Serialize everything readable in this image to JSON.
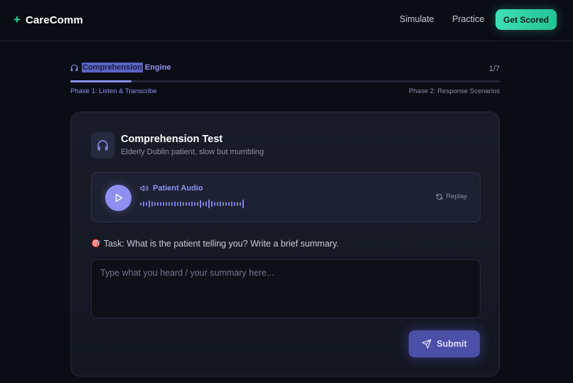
{
  "header": {
    "logo_symbol": "+",
    "logo_text": "CareComm",
    "nav": [
      "Simulate",
      "Practice"
    ],
    "cta_label": "Get Scored"
  },
  "progress": {
    "engine_highlight": "Comprehension",
    "engine_rest": " Engine",
    "step": "1/7",
    "fraction_complete": 0.143,
    "phase_current": "Phase 1: Listen & Transcribe",
    "phase_next": "Phase 2: Response Scenarios"
  },
  "card": {
    "title": "Comprehension Test",
    "subtitle": "Elderly Dublin patient, slow but mumbling",
    "icon": "headphones-icon"
  },
  "audio": {
    "label": "Patient Audio",
    "replay_label": "Replay",
    "waveform_levels": [
      0.3,
      0.5,
      0.4,
      0.7,
      0.5,
      0.4,
      0.4,
      0.4,
      0.4,
      0.4,
      0.4,
      0.4,
      0.5,
      0.4,
      0.5,
      0.4,
      0.4,
      0.4,
      0.5,
      0.4,
      0.4,
      0.8,
      0.4,
      0.5,
      0.9,
      0.6,
      0.4,
      0.4,
      0.5,
      0.4,
      0.4,
      0.4,
      0.5,
      0.4,
      0.4,
      0.4,
      0.9
    ]
  },
  "task": {
    "emoji": "🎯",
    "text": "Task: What is the patient telling you? Write a brief summary.",
    "placeholder": "Type what you heard / your summary here...",
    "value": ""
  },
  "submit_label": "Submit",
  "colors": {
    "accent_green": "#2fd6a6",
    "accent_purple": "#8f93f5",
    "background": "#0b0d15"
  }
}
